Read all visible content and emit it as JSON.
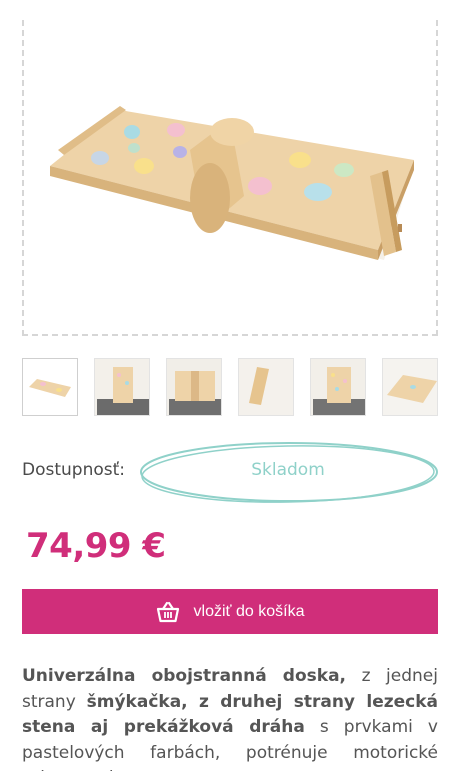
{
  "product": {
    "image_name": "wooden-climbing-board-image",
    "thumbnails": [
      {
        "name": "thumb-board-flat"
      },
      {
        "name": "thumb-wall-front"
      },
      {
        "name": "thumb-board-angled"
      },
      {
        "name": "thumb-board-side"
      },
      {
        "name": "thumb-wall-holds"
      },
      {
        "name": "thumb-board-ramp"
      }
    ],
    "availability_label": "Dostupnosť:",
    "availability_value": "Skladom",
    "price": "74,99 €",
    "cart_button_label": "vložiť do košíka",
    "cart_icon": "basket-icon",
    "description": {
      "part1_bold": "Univerzálna obojstranná doska,",
      "part2": " z jednej strany ",
      "part3_bold": "šmýkačka, z druhej strany lezecká stena aj prekážková dráha",
      "part4": " s prvkami v pastelových farbách, potrénuje motorické schopnosti,"
    }
  },
  "colors": {
    "accent": "#d02e7a",
    "stock": "#8fd1c9"
  }
}
